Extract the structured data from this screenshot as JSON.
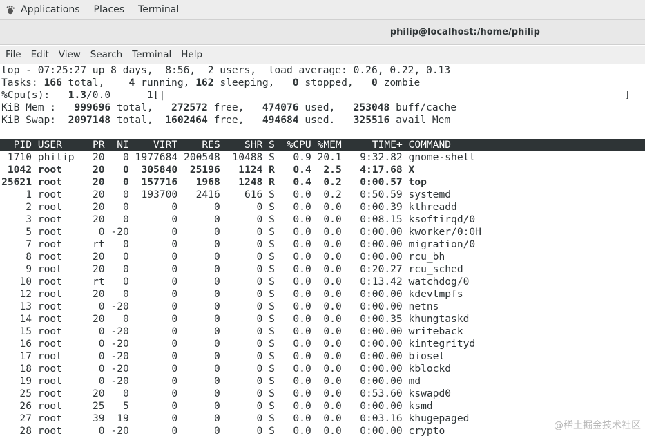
{
  "gnome_bar": {
    "applications_label": "Applications",
    "places_label": "Places",
    "terminal_label": "Terminal"
  },
  "window": {
    "title": "philip@localhost:/home/philip"
  },
  "menu": [
    "File",
    "Edit",
    "View",
    "Search",
    "Terminal",
    "Help"
  ],
  "top": {
    "line1": "top - 07:25:27 up 8 days,  8:56,  2 users,  load average: 0.26, 0.22, 0.13",
    "tasks": {
      "label": "Tasks:",
      "total": "166",
      "running": "4",
      "sleeping": "162",
      "stopped": "0",
      "zombie": "0"
    },
    "cpu": {
      "label": "%Cpu(s):",
      "value": "1.3",
      "rest": "/0.0",
      "bar_label": "1[|",
      "bar_end": "]"
    },
    "mem": {
      "label": "KiB Mem :",
      "total": "999696",
      "free": "272572",
      "used": "474076",
      "buff_cache": "253048"
    },
    "swap": {
      "label": "KiB Swap:",
      "total": "2097148",
      "free": "1602464",
      "used": "494684",
      "avail": "325516"
    }
  },
  "columns": [
    "PID",
    "USER",
    "PR",
    "NI",
    "VIRT",
    "RES",
    "SHR",
    "S",
    "%CPU",
    "%MEM",
    "TIME+",
    "COMMAND"
  ],
  "processes": [
    {
      "pid": "1710",
      "user": "philip",
      "pr": "20",
      "ni": "0",
      "virt": "1977684",
      "res": "200548",
      "shr": "10488",
      "s": "S",
      "cpu": "0.9",
      "mem": "20.1",
      "time": "9:32.82",
      "cmd": "gnome-shell",
      "bold": false
    },
    {
      "pid": "1042",
      "user": "root",
      "pr": "20",
      "ni": "0",
      "virt": "305840",
      "res": "25196",
      "shr": "1124",
      "s": "R",
      "cpu": "0.4",
      "mem": "2.5",
      "time": "4:17.68",
      "cmd": "X",
      "bold": true
    },
    {
      "pid": "25621",
      "user": "root",
      "pr": "20",
      "ni": "0",
      "virt": "157716",
      "res": "1968",
      "shr": "1248",
      "s": "R",
      "cpu": "0.4",
      "mem": "0.2",
      "time": "0:00.57",
      "cmd": "top",
      "bold": true
    },
    {
      "pid": "1",
      "user": "root",
      "pr": "20",
      "ni": "0",
      "virt": "193700",
      "res": "2416",
      "shr": "616",
      "s": "S",
      "cpu": "0.0",
      "mem": "0.2",
      "time": "0:50.59",
      "cmd": "systemd",
      "bold": false
    },
    {
      "pid": "2",
      "user": "root",
      "pr": "20",
      "ni": "0",
      "virt": "0",
      "res": "0",
      "shr": "0",
      "s": "S",
      "cpu": "0.0",
      "mem": "0.0",
      "time": "0:00.39",
      "cmd": "kthreadd",
      "bold": false
    },
    {
      "pid": "3",
      "user": "root",
      "pr": "20",
      "ni": "0",
      "virt": "0",
      "res": "0",
      "shr": "0",
      "s": "S",
      "cpu": "0.0",
      "mem": "0.0",
      "time": "0:08.15",
      "cmd": "ksoftirqd/0",
      "bold": false
    },
    {
      "pid": "5",
      "user": "root",
      "pr": "0",
      "ni": "-20",
      "virt": "0",
      "res": "0",
      "shr": "0",
      "s": "S",
      "cpu": "0.0",
      "mem": "0.0",
      "time": "0:00.00",
      "cmd": "kworker/0:0H",
      "bold": false
    },
    {
      "pid": "7",
      "user": "root",
      "pr": "rt",
      "ni": "0",
      "virt": "0",
      "res": "0",
      "shr": "0",
      "s": "S",
      "cpu": "0.0",
      "mem": "0.0",
      "time": "0:00.00",
      "cmd": "migration/0",
      "bold": false
    },
    {
      "pid": "8",
      "user": "root",
      "pr": "20",
      "ni": "0",
      "virt": "0",
      "res": "0",
      "shr": "0",
      "s": "S",
      "cpu": "0.0",
      "mem": "0.0",
      "time": "0:00.00",
      "cmd": "rcu_bh",
      "bold": false
    },
    {
      "pid": "9",
      "user": "root",
      "pr": "20",
      "ni": "0",
      "virt": "0",
      "res": "0",
      "shr": "0",
      "s": "S",
      "cpu": "0.0",
      "mem": "0.0",
      "time": "0:20.27",
      "cmd": "rcu_sched",
      "bold": false
    },
    {
      "pid": "10",
      "user": "root",
      "pr": "rt",
      "ni": "0",
      "virt": "0",
      "res": "0",
      "shr": "0",
      "s": "S",
      "cpu": "0.0",
      "mem": "0.0",
      "time": "0:13.42",
      "cmd": "watchdog/0",
      "bold": false
    },
    {
      "pid": "12",
      "user": "root",
      "pr": "20",
      "ni": "0",
      "virt": "0",
      "res": "0",
      "shr": "0",
      "s": "S",
      "cpu": "0.0",
      "mem": "0.0",
      "time": "0:00.00",
      "cmd": "kdevtmpfs",
      "bold": false
    },
    {
      "pid": "13",
      "user": "root",
      "pr": "0",
      "ni": "-20",
      "virt": "0",
      "res": "0",
      "shr": "0",
      "s": "S",
      "cpu": "0.0",
      "mem": "0.0",
      "time": "0:00.00",
      "cmd": "netns",
      "bold": false
    },
    {
      "pid": "14",
      "user": "root",
      "pr": "20",
      "ni": "0",
      "virt": "0",
      "res": "0",
      "shr": "0",
      "s": "S",
      "cpu": "0.0",
      "mem": "0.0",
      "time": "0:00.35",
      "cmd": "khungtaskd",
      "bold": false
    },
    {
      "pid": "15",
      "user": "root",
      "pr": "0",
      "ni": "-20",
      "virt": "0",
      "res": "0",
      "shr": "0",
      "s": "S",
      "cpu": "0.0",
      "mem": "0.0",
      "time": "0:00.00",
      "cmd": "writeback",
      "bold": false
    },
    {
      "pid": "16",
      "user": "root",
      "pr": "0",
      "ni": "-20",
      "virt": "0",
      "res": "0",
      "shr": "0",
      "s": "S",
      "cpu": "0.0",
      "mem": "0.0",
      "time": "0:00.00",
      "cmd": "kintegrityd",
      "bold": false
    },
    {
      "pid": "17",
      "user": "root",
      "pr": "0",
      "ni": "-20",
      "virt": "0",
      "res": "0",
      "shr": "0",
      "s": "S",
      "cpu": "0.0",
      "mem": "0.0",
      "time": "0:00.00",
      "cmd": "bioset",
      "bold": false
    },
    {
      "pid": "18",
      "user": "root",
      "pr": "0",
      "ni": "-20",
      "virt": "0",
      "res": "0",
      "shr": "0",
      "s": "S",
      "cpu": "0.0",
      "mem": "0.0",
      "time": "0:00.00",
      "cmd": "kblockd",
      "bold": false
    },
    {
      "pid": "19",
      "user": "root",
      "pr": "0",
      "ni": "-20",
      "virt": "0",
      "res": "0",
      "shr": "0",
      "s": "S",
      "cpu": "0.0",
      "mem": "0.0",
      "time": "0:00.00",
      "cmd": "md",
      "bold": false
    },
    {
      "pid": "25",
      "user": "root",
      "pr": "20",
      "ni": "0",
      "virt": "0",
      "res": "0",
      "shr": "0",
      "s": "S",
      "cpu": "0.0",
      "mem": "0.0",
      "time": "0:53.60",
      "cmd": "kswapd0",
      "bold": false
    },
    {
      "pid": "26",
      "user": "root",
      "pr": "25",
      "ni": "5",
      "virt": "0",
      "res": "0",
      "shr": "0",
      "s": "S",
      "cpu": "0.0",
      "mem": "0.0",
      "time": "0:00.00",
      "cmd": "ksmd",
      "bold": false
    },
    {
      "pid": "27",
      "user": "root",
      "pr": "39",
      "ni": "19",
      "virt": "0",
      "res": "0",
      "shr": "0",
      "s": "S",
      "cpu": "0.0",
      "mem": "0.0",
      "time": "0:03.16",
      "cmd": "khugepaged",
      "bold": false
    },
    {
      "pid": "28",
      "user": "root",
      "pr": "0",
      "ni": "-20",
      "virt": "0",
      "res": "0",
      "shr": "0",
      "s": "S",
      "cpu": "0.0",
      "mem": "0.0",
      "time": "0:00.00",
      "cmd": "crypto",
      "bold": false
    }
  ],
  "watermark": "@稀土掘金技术社区",
  "colors": {
    "header_bg": "#2e3436",
    "header_fg": "#ffffff",
    "text": "#2e3436"
  }
}
